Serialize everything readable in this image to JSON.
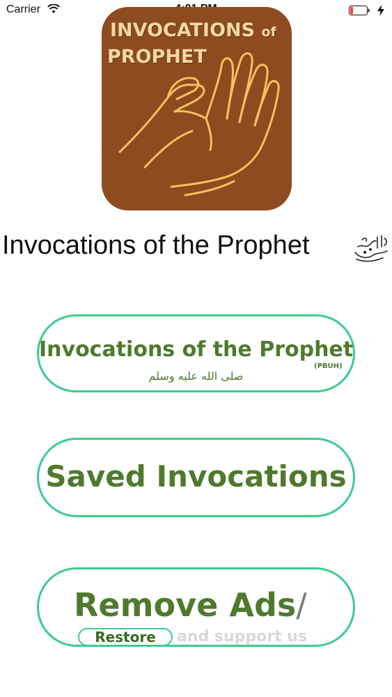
{
  "status_bar": {
    "carrier": "Carrier",
    "time": "4:01 PM",
    "battery_color": "#ff3b30"
  },
  "logo": {
    "line1": "INVOCATIONS",
    "line1_of": "of",
    "line2": "PROPHET",
    "background_color": "#8d4b1f",
    "text_color": "#f3d8a4"
  },
  "page": {
    "title": "Invocations of the Prophet"
  },
  "buttons": {
    "invocations": {
      "label": "Invocations of the Prophet",
      "pbuh": "(PBUH)",
      "arabic": "صلى الله عليه وسلم"
    },
    "saved": {
      "label": "Saved Invocations"
    },
    "remove_ads": {
      "label": "Remove Ads",
      "slash": "/",
      "restore": "Restore",
      "support": "and support us"
    },
    "border_color": "#3dcb8f",
    "text_color": "#4f7a2d"
  }
}
